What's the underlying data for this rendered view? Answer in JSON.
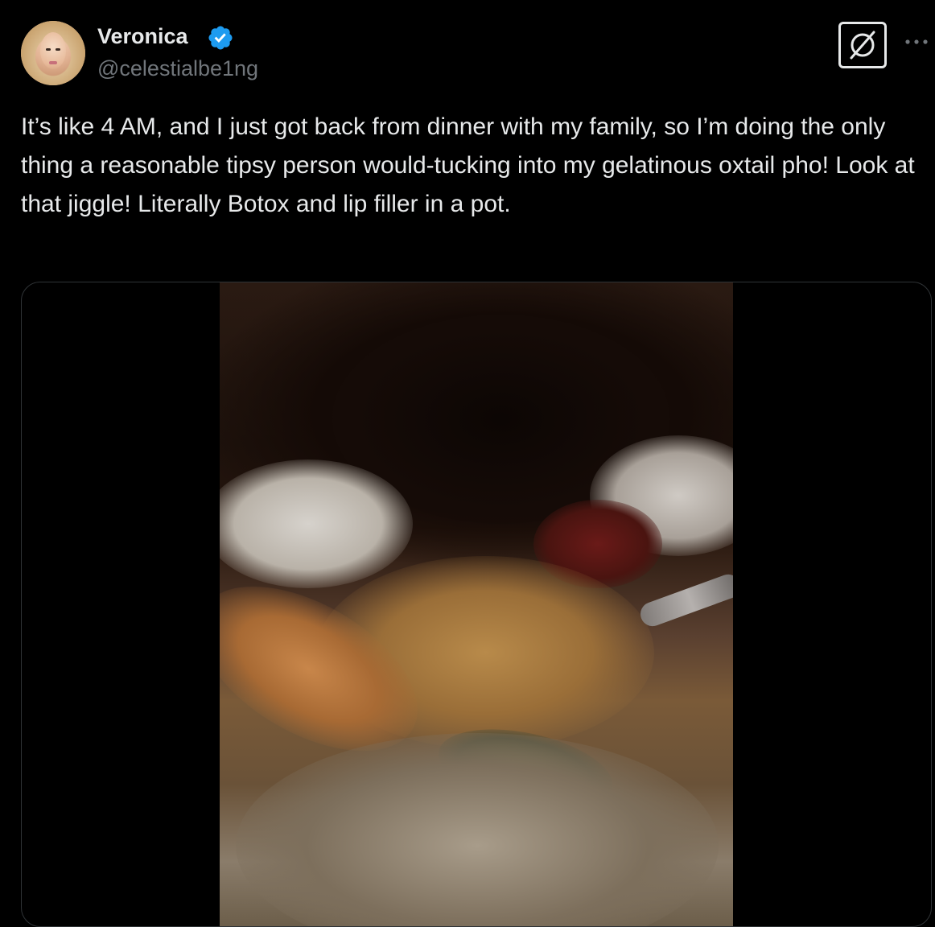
{
  "author": {
    "name": "Veronica",
    "handle": "@celestialbe1ng",
    "verified": true
  },
  "icons": {
    "verified": "verified-badge-icon",
    "grok": "grok-icon",
    "more": "more-options-icon"
  },
  "tweet": {
    "text": "It’s like 4 AM, and I just got back from dinner with my family, so I’m doing the only thing a reasonable tipsy person would-tucking into my gelatinous oxtail pho! Look at that jiggle! Literally Botox and lip filler in a pot."
  },
  "colors": {
    "background": "#000000",
    "text": "#e7e9ea",
    "secondary_text": "#71767b",
    "verified_blue": "#1d9bf0",
    "border": "#2f3336"
  }
}
